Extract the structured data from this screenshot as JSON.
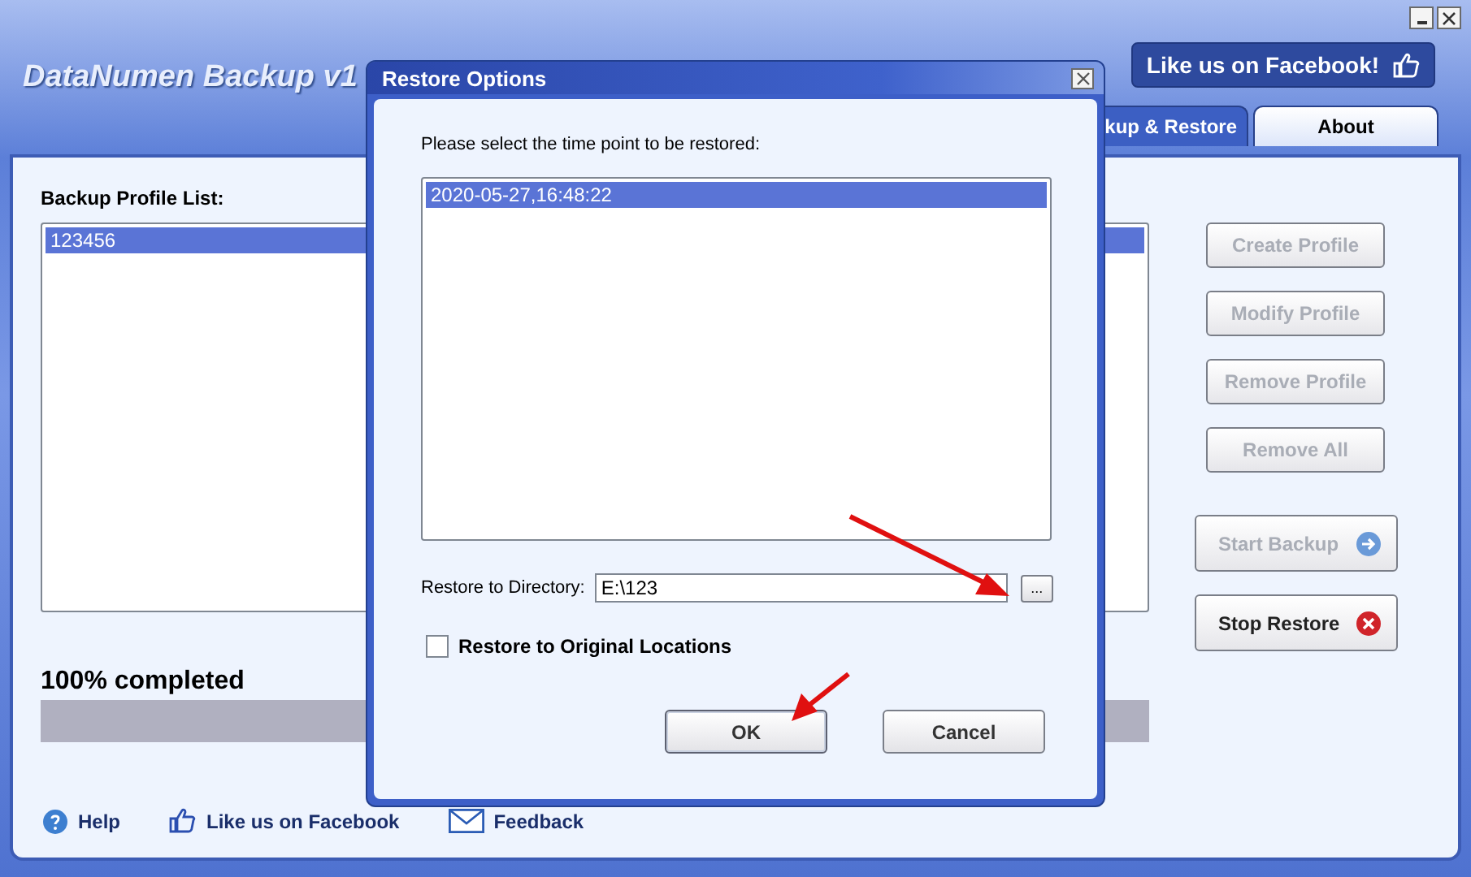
{
  "window": {
    "title": "DataNumen Backup v1",
    "controls": [
      {
        "kind": "minimize"
      },
      {
        "kind": "close"
      }
    ]
  },
  "facebook_banner": {
    "label": "Like us on Facebook!"
  },
  "tabs": [
    {
      "label": "kup & Restore",
      "selected": true
    },
    {
      "label": "About",
      "selected": false
    }
  ],
  "profile_list": {
    "label": "Backup Profile List:",
    "items": [
      {
        "label": "123456",
        "selected": true
      }
    ]
  },
  "buttons": [
    {
      "label": "Create Profile",
      "disabled": true,
      "kind": "plain"
    },
    {
      "label": "Modify Profile",
      "disabled": true,
      "kind": "plain"
    },
    {
      "label": "Remove Profile",
      "disabled": true,
      "kind": "plain"
    },
    {
      "label": "Remove All",
      "disabled": true,
      "kind": "plain"
    },
    {
      "label": "Start Backup",
      "disabled": true,
      "kind": "start"
    },
    {
      "label": "Stop Restore",
      "disabled": false,
      "kind": "stop"
    }
  ],
  "progress": {
    "label": "100% completed",
    "level": 1
  },
  "footer_links": [
    {
      "label": "Help",
      "kind": "help"
    },
    {
      "label": "Like us on Facebook",
      "kind": "like"
    },
    {
      "label": "Feedback",
      "kind": "mail"
    }
  ],
  "dialog": {
    "title": "Restore Options",
    "prompt": "Please select the time point to be restored:",
    "time_points": [
      {
        "label": "2020-05-27,16:48:22",
        "selected": true
      }
    ],
    "directory": {
      "label": "Restore to Directory:",
      "value": "E:\\123",
      "browse": "..."
    },
    "checkbox": {
      "label": "Restore to Original Locations",
      "checked": false
    },
    "buttons": [
      {
        "label": "OK",
        "default": true
      },
      {
        "label": "Cancel",
        "default": false
      }
    ]
  }
}
